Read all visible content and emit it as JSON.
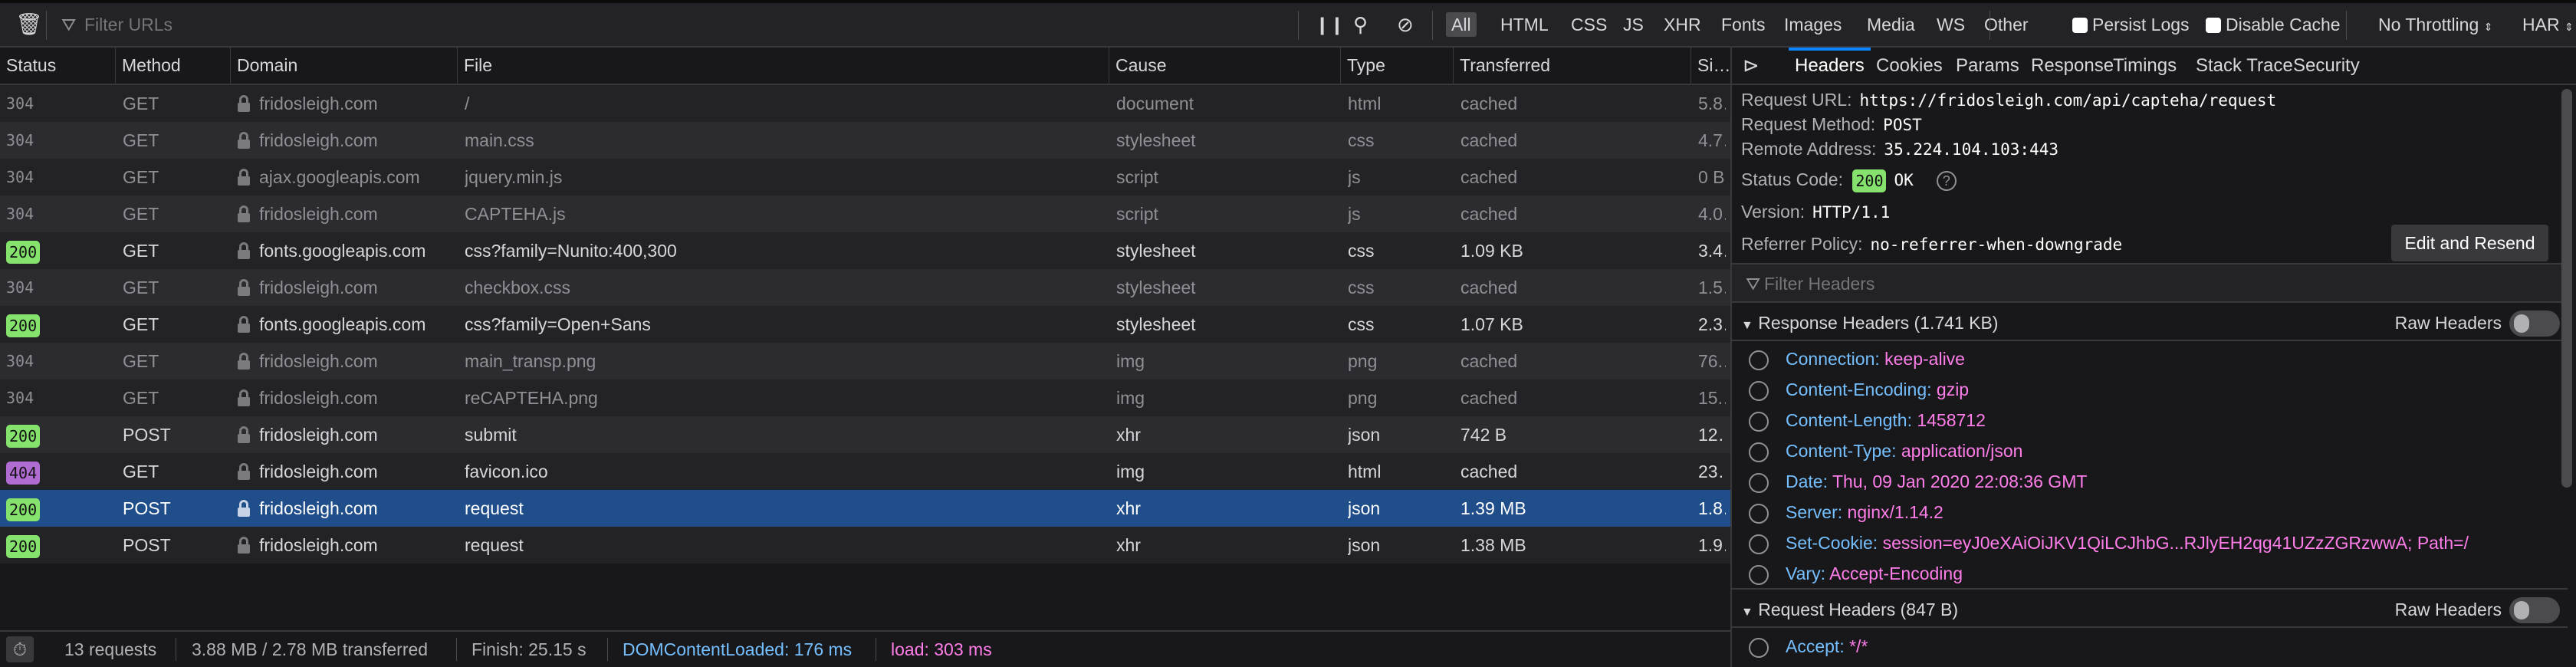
{
  "toolbar": {
    "filter_placeholder": "Filter URLs",
    "filter_tabs": [
      "All",
      "HTML",
      "CSS",
      "JS",
      "XHR",
      "Fonts",
      "Images",
      "Media",
      "WS",
      "Other"
    ],
    "active_filter": "All",
    "persist_logs": "Persist Logs",
    "disable_cache": "Disable Cache",
    "throttling": "No Throttling",
    "har": "HAR"
  },
  "table": {
    "columns": [
      "Status",
      "Method",
      "Domain",
      "File",
      "Cause",
      "Type",
      "Transferred",
      "Si…"
    ],
    "rows": [
      {
        "status": "304",
        "method": "GET",
        "domain": "fridosleigh.com",
        "file": "/",
        "cause": "document",
        "type": "html",
        "transferred": "cached",
        "size": "5.8…"
      },
      {
        "status": "304",
        "method": "GET",
        "domain": "fridosleigh.com",
        "file": "main.css",
        "cause": "stylesheet",
        "type": "css",
        "transferred": "cached",
        "size": "4.7…"
      },
      {
        "status": "304",
        "method": "GET",
        "domain": "ajax.googleapis.com",
        "file": "jquery.min.js",
        "cause": "script",
        "type": "js",
        "transferred": "cached",
        "size": "0 B"
      },
      {
        "status": "304",
        "method": "GET",
        "domain": "fridosleigh.com",
        "file": "CAPTEHA.js",
        "cause": "script",
        "type": "js",
        "transferred": "cached",
        "size": "4.0…"
      },
      {
        "status": "200",
        "method": "GET",
        "domain": "fonts.googleapis.com",
        "file": "css?family=Nunito:400,300",
        "cause": "stylesheet",
        "type": "css",
        "transferred": "1.09 KB",
        "size": "3.4…"
      },
      {
        "status": "304",
        "method": "GET",
        "domain": "fridosleigh.com",
        "file": "checkbox.css",
        "cause": "stylesheet",
        "type": "css",
        "transferred": "cached",
        "size": "1.5…"
      },
      {
        "status": "200",
        "method": "GET",
        "domain": "fonts.googleapis.com",
        "file": "css?family=Open+Sans",
        "cause": "stylesheet",
        "type": "css",
        "transferred": "1.07 KB",
        "size": "2.3…"
      },
      {
        "status": "304",
        "method": "GET",
        "domain": "fridosleigh.com",
        "file": "main_transp.png",
        "cause": "img",
        "type": "png",
        "transferred": "cached",
        "size": "76.…"
      },
      {
        "status": "304",
        "method": "GET",
        "domain": "fridosleigh.com",
        "file": "reCAPTEHA.png",
        "cause": "img",
        "type": "png",
        "transferred": "cached",
        "size": "15.…"
      },
      {
        "status": "200",
        "method": "POST",
        "domain": "fridosleigh.com",
        "file": "submit",
        "cause": "xhr",
        "type": "json",
        "transferred": "742 B",
        "size": "12…"
      },
      {
        "status": "404",
        "method": "GET",
        "domain": "fridosleigh.com",
        "file": "favicon.ico",
        "cause": "img",
        "type": "html",
        "transferred": "cached",
        "size": "23…"
      },
      {
        "status": "200",
        "method": "POST",
        "domain": "fridosleigh.com",
        "file": "request",
        "cause": "xhr",
        "type": "json",
        "transferred": "1.39 MB",
        "size": "1.8…",
        "selected": true
      },
      {
        "status": "200",
        "method": "POST",
        "domain": "fridosleigh.com",
        "file": "request",
        "cause": "xhr",
        "type": "json",
        "transferred": "1.38 MB",
        "size": "1.9…"
      }
    ]
  },
  "colors": {
    "status_200": "#85e26c",
    "status_404": "#b06cd0",
    "selected_row": "#204e8a",
    "accent": "#0a84ff"
  },
  "panel": {
    "tabs": [
      "Headers",
      "Cookies",
      "Params",
      "Response",
      "Timings",
      "Stack Trace",
      "Security"
    ],
    "active_tab": "Headers",
    "summary": {
      "request_url_label": "Request URL:",
      "request_url": "https://fridosleigh.com/api/capteha/request",
      "method_label": "Request Method:",
      "method": "POST",
      "remote_label": "Remote Address:",
      "remote": "35.224.104.103:443",
      "status_label": "Status Code:",
      "status_code": "200",
      "status_text": "OK",
      "version_label": "Version:",
      "version": "HTTP/1.1",
      "referrer_label": "Referrer Policy:",
      "referrer": "no-referrer-when-downgrade"
    },
    "edit_resend": "Edit and Resend",
    "filter_headers_placeholder": "Filter Headers",
    "response_headers_title": "Response Headers (1.741 KB)",
    "raw_headers": "Raw Headers",
    "response_headers": [
      {
        "name": "Connection:",
        "value": "keep-alive"
      },
      {
        "name": "Content-Encoding:",
        "value": "gzip"
      },
      {
        "name": "Content-Length:",
        "value": "1458712"
      },
      {
        "name": "Content-Type:",
        "value": "application/json"
      },
      {
        "name": "Date:",
        "value": "Thu, 09 Jan 2020 22:08:36 GMT"
      },
      {
        "name": "Server:",
        "value": "nginx/1.14.2"
      },
      {
        "name": "Set-Cookie:",
        "value": "session=eyJ0eXAiOiJKV1QiLCJhbG...RJlyEH2qg41UZzZGRzwwA; Path=/"
      },
      {
        "name": "Vary:",
        "value": "Accept-Encoding"
      }
    ],
    "request_headers_title": "Request Headers (847 B)",
    "request_headers": [
      {
        "name": "Accept:",
        "value": "*/*"
      }
    ]
  },
  "statusbar": {
    "requests": "13 requests",
    "transferred": "3.88 MB / 2.78 MB transferred",
    "finish": "Finish: 25.15 s",
    "dcl": "DOMContentLoaded: 176 ms",
    "load": "load: 303 ms"
  }
}
